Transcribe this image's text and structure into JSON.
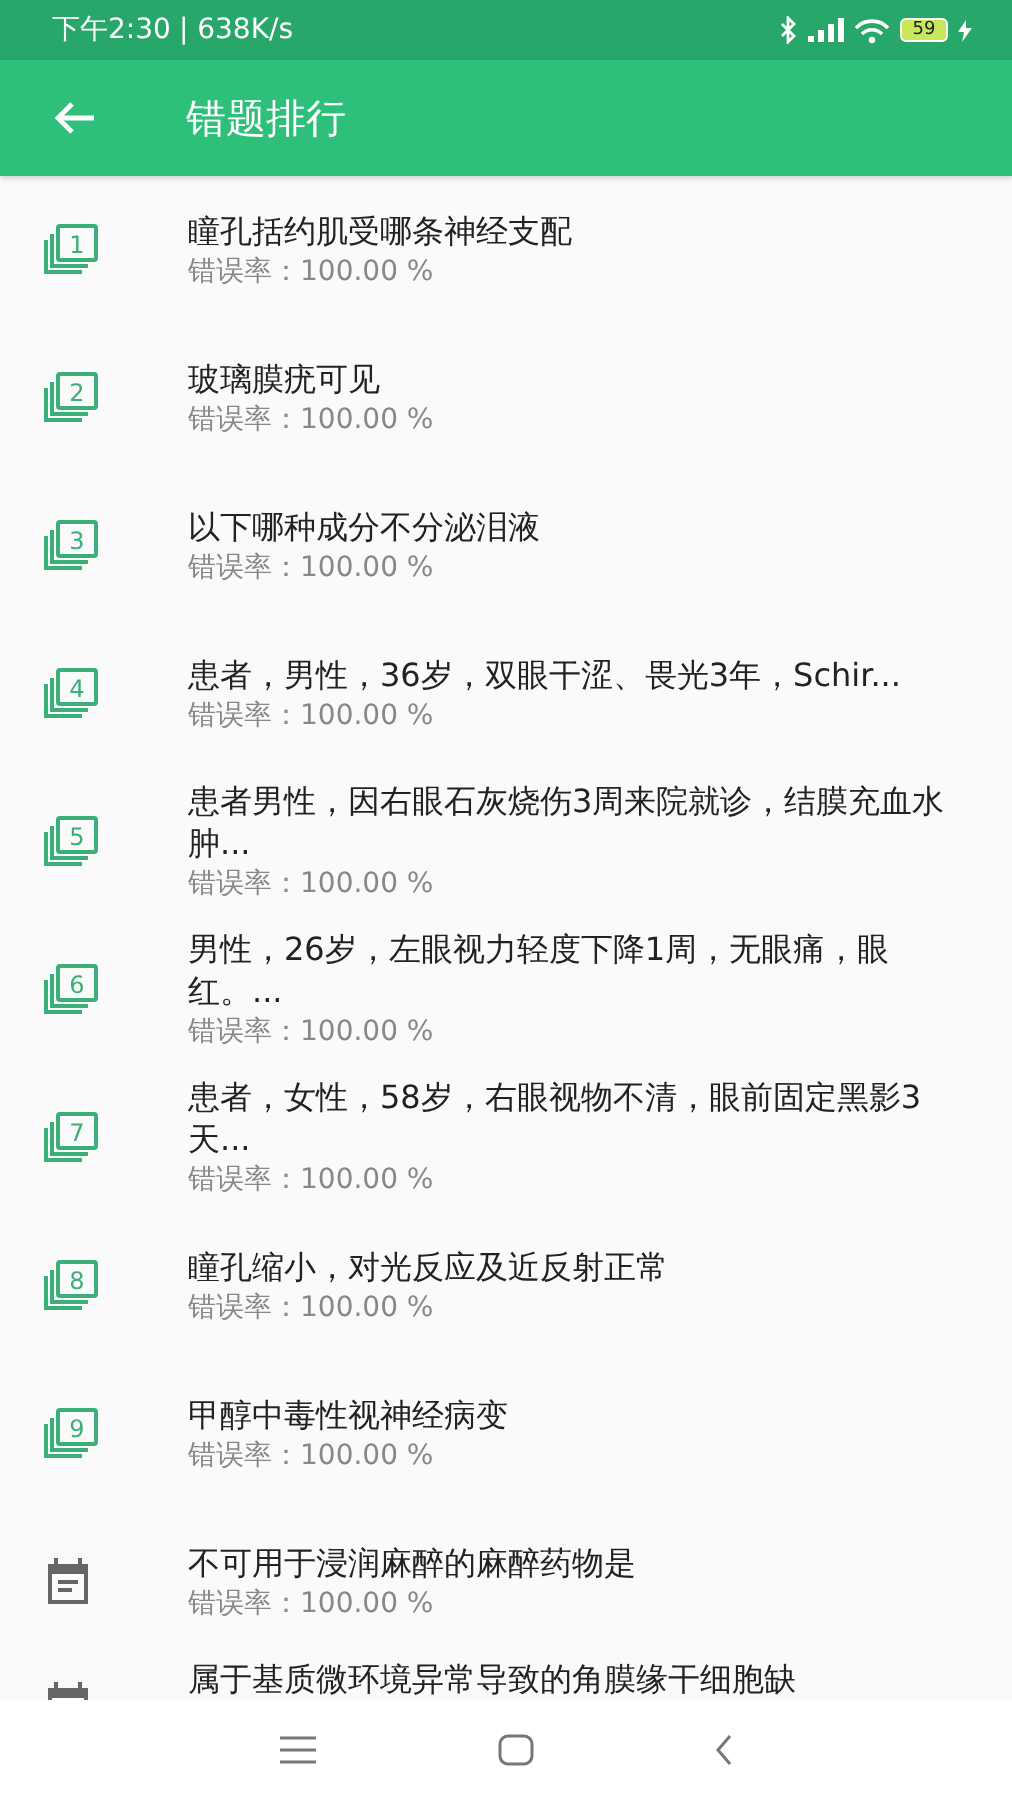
{
  "status_bar": {
    "time": "下午2:30",
    "speed": "| 638K/s",
    "battery": "59"
  },
  "app_bar": {
    "title": "错题排行"
  },
  "items": [
    {
      "kind": "number",
      "badge": "1",
      "title": "瞳孔括约肌受哪条神经支配",
      "rate": "错误率：100.00 %"
    },
    {
      "kind": "number",
      "badge": "2",
      "title": "玻璃膜疣可见",
      "rate": "错误率：100.00 %"
    },
    {
      "kind": "number",
      "badge": "3",
      "title": "以下哪种成分不分泌泪液",
      "rate": "错误率：100.00 %"
    },
    {
      "kind": "number",
      "badge": "4",
      "title": "患者，男性，36岁，双眼干涩、畏光3年，Schir...",
      "rate": "错误率：100.00 %"
    },
    {
      "kind": "number",
      "badge": "5",
      "title": "患者男性，因右眼石灰烧伤3周来院就诊，结膜充血水肿...",
      "rate": "错误率：100.00 %"
    },
    {
      "kind": "number",
      "badge": "6",
      "title": "男性，26岁，左眼视力轻度下降1周，无眼痛，眼红。...",
      "rate": "错误率：100.00 %"
    },
    {
      "kind": "number",
      "badge": "7",
      "title": "患者，女性，58岁，右眼视物不清，眼前固定黑影3天...",
      "rate": "错误率：100.00 %"
    },
    {
      "kind": "number",
      "badge": "8",
      "title": "瞳孔缩小，对光反应及近反射正常",
      "rate": "错误率：100.00 %"
    },
    {
      "kind": "number",
      "badge": "9",
      "title": "甲醇中毒性视神经病变",
      "rate": "错误率：100.00 %"
    },
    {
      "kind": "calendar",
      "title": "不可用于浸润麻醉的麻醉药物是",
      "rate": "错误率：100.00 %"
    },
    {
      "kind": "calendar",
      "title": "属于基质微环境异常导致的角膜缘干细胞缺"
    }
  ]
}
